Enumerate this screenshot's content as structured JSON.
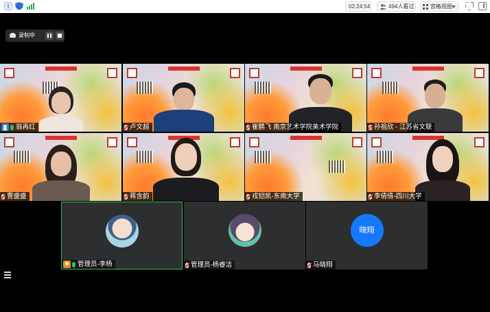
{
  "topbar": {
    "time": "02:24:54",
    "viewers": "494人看过",
    "view_mode": "宫格视图"
  },
  "recording": {
    "label": "录制中"
  },
  "tiles": [
    {
      "name": "翁再红",
      "mic": "on",
      "host": true
    },
    {
      "name": "卢文超",
      "mic": "muted"
    },
    {
      "name": "崔鹏飞 南京艺术学院美术学院",
      "mic": "muted"
    },
    {
      "name": "孙祖欣 - 江苏省文联",
      "mic": "muted"
    },
    {
      "name": "曹盛盛",
      "mic": "muted"
    },
    {
      "name": "蒋含韵",
      "mic": "muted"
    },
    {
      "name": "戎铠凯-东南大学",
      "mic": "muted"
    },
    {
      "name": "李倩倩-四川大学",
      "mic": "muted"
    }
  ],
  "audio_tiles": [
    {
      "name": "管理员-李杨",
      "mic": "on",
      "admin": true,
      "avatar": "anime-avatar"
    },
    {
      "name": "管理员-杨睿洁",
      "mic": "muted",
      "avatar": "anime-avatar"
    },
    {
      "name": "马晓翔",
      "mic": "muted",
      "avatar_text": "晓翔"
    }
  ]
}
